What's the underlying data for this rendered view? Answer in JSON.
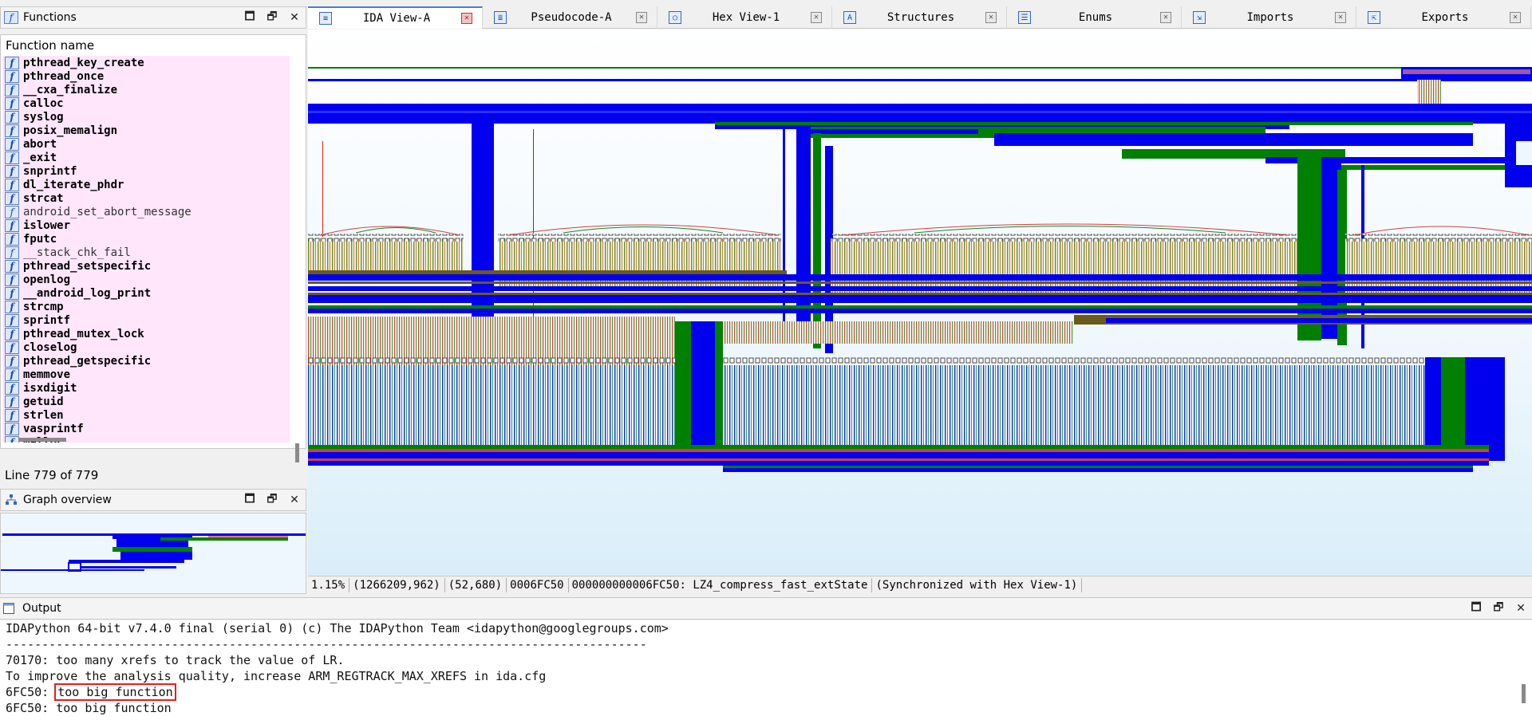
{
  "functions_panel": {
    "title": "Functions",
    "column_header": "Function name",
    "items": [
      {
        "name": "pthread_key_create",
        "bold": true
      },
      {
        "name": "pthread_once",
        "bold": true
      },
      {
        "name": "__cxa_finalize",
        "bold": true
      },
      {
        "name": "calloc",
        "bold": true
      },
      {
        "name": "syslog",
        "bold": true
      },
      {
        "name": "posix_memalign",
        "bold": true
      },
      {
        "name": "abort",
        "bold": true
      },
      {
        "name": "_exit",
        "bold": true
      },
      {
        "name": "snprintf",
        "bold": true
      },
      {
        "name": "dl_iterate_phdr",
        "bold": true
      },
      {
        "name": "strcat",
        "bold": true
      },
      {
        "name": "android_set_abort_message",
        "bold": false
      },
      {
        "name": "islower",
        "bold": true
      },
      {
        "name": "fputc",
        "bold": true
      },
      {
        "name": "__stack_chk_fail",
        "bold": false
      },
      {
        "name": "pthread_setspecific",
        "bold": true
      },
      {
        "name": "openlog",
        "bold": true
      },
      {
        "name": "__android_log_print",
        "bold": true
      },
      {
        "name": "strcmp",
        "bold": true
      },
      {
        "name": "sprintf",
        "bold": true
      },
      {
        "name": "pthread_mutex_lock",
        "bold": true
      },
      {
        "name": "closelog",
        "bold": true
      },
      {
        "name": "pthread_getspecific",
        "bold": true
      },
      {
        "name": "memmove",
        "bold": true
      },
      {
        "name": "isxdigit",
        "bold": true
      },
      {
        "name": "getuid",
        "bold": true
      },
      {
        "name": "strlen",
        "bold": true
      },
      {
        "name": "vasprintf",
        "bold": true
      },
      {
        "name": "malloc",
        "bold": true
      }
    ],
    "line_status": "Line 779 of 779"
  },
  "graph_overview": {
    "title": "Graph overview"
  },
  "tabs": [
    {
      "label": "IDA View-A",
      "active": true
    },
    {
      "label": "Pseudocode-A",
      "active": false
    },
    {
      "label": "Hex View-1",
      "active": false
    },
    {
      "label": "Structures",
      "active": false
    },
    {
      "label": "Enums",
      "active": false
    },
    {
      "label": "Imports",
      "active": false
    },
    {
      "label": "Exports",
      "active": false
    }
  ],
  "status_bar": {
    "zoom": "1.15%",
    "coords": "(1266209,962)",
    "pos": "(52,680)",
    "offset": "0006FC50",
    "address": "000000000006FC50: LZ4_compress_fast_extState",
    "sync": "(Synchronized with Hex View-1)"
  },
  "output_panel": {
    "title": "Output",
    "lines": [
      "IDAPython 64-bit v7.4.0 final (serial 0) (c) The IDAPython Team <idapython@googlegroups.com>",
      "-----------------------------------------------------------------------------------------",
      "70170: too many xrefs to track the value of LR.",
      "To improve the analysis quality, increase ARM_REGTRACK_MAX_XREFS in ida.cfg"
    ],
    "highlight_line": {
      "prefix": "6FC50: ",
      "text": "too big function"
    },
    "last_line": "6FC50: too big function"
  },
  "colors": {
    "graph_blue": "#0000ee",
    "graph_green": "#008000",
    "graph_olive": "#6b5a1e",
    "graph_red": "#e02020"
  }
}
